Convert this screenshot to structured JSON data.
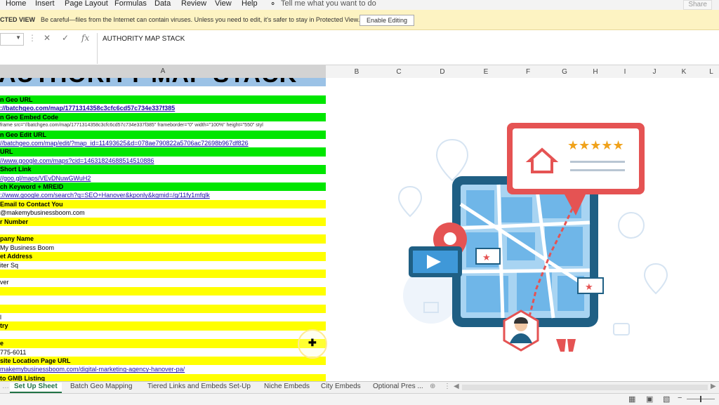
{
  "menu": [
    "Home",
    "Insert",
    "Page Layout",
    "Formulas",
    "Data",
    "Review",
    "View",
    "Help"
  ],
  "tell_me": "Tell me what you want to do",
  "share": "Share",
  "protected_view": {
    "title": "CTED VIEW",
    "message": "Be careful—files from the Internet can contain viruses. Unless you need to edit, it's safer to stay in Protected View.",
    "button": "Enable Editing"
  },
  "formula_bar": {
    "fx": "fx",
    "content": "AUTHORITY MAP STACK"
  },
  "columns": [
    "A",
    "B",
    "C",
    "D",
    "E",
    "F",
    "G",
    "H",
    "I",
    "J",
    "K",
    "L"
  ],
  "banner_text": "AUTHORITY MAP STACK",
  "rows": [
    {
      "style": "green",
      "text": "n Geo URL"
    },
    {
      "style": "linkb",
      "text": "://batchgeo.com/map/1771314358c3cfc6cd57c734e337f385"
    },
    {
      "style": "green",
      "text": "n Geo Embed Code"
    },
    {
      "style": "small",
      "text": "frame src=\"//batchgeo.com/map/1771314358c3cfc6cd57c734e337f385\" frameborder=\"0\" width=\"100%\" height=\"550\" styl"
    },
    {
      "style": "green",
      "text": "n Geo Edit URL"
    },
    {
      "style": "link",
      "text": "//batchgeo.com/map/edit/?map_id=11493625&d=078ae790822a5706ac72698b967df826"
    },
    {
      "style": "green",
      "text": "URL"
    },
    {
      "style": "link",
      "text": "//www.google.com/maps?cid=14631824688514510886"
    },
    {
      "style": "green",
      "text": " Short Link"
    },
    {
      "style": "link",
      "text": "//goo.gl/maps/VEvDNuwGWuH2"
    },
    {
      "style": "green",
      "text": "ch Keyword + MREID"
    },
    {
      "style": "link",
      "text": "://www.google.com/search?q=SEO+Hanover&kponly&kgmid=/g/11fy1mfqlk"
    },
    {
      "style": "yellow",
      "text": "Email to Contact You"
    },
    {
      "style": "plain",
      "text": "@makemybusinessboom.com"
    },
    {
      "style": "yellow",
      "text": "r Number"
    },
    {
      "style": "plain",
      "text": ""
    },
    {
      "style": "yellow",
      "text": "pany Name"
    },
    {
      "style": "plain",
      "text": " My Business Boom"
    },
    {
      "style": "yellow",
      "text": "et Address"
    },
    {
      "style": "plain",
      "text": "iter Sq"
    },
    {
      "style": "yellow",
      "text": ""
    },
    {
      "style": "plain",
      "text": "ver"
    },
    {
      "style": "yellow",
      "text": ""
    },
    {
      "style": "plain",
      "text": ""
    },
    {
      "style": "yellow",
      "text": ""
    },
    {
      "style": "plain",
      "text": "l"
    },
    {
      "style": "yellow",
      "text": "try"
    },
    {
      "style": "plain",
      "text": ""
    },
    {
      "style": "yellow",
      "text": "e"
    },
    {
      "style": "plain",
      "text": " 775-6011"
    },
    {
      "style": "yellow",
      "text": "site Location Page URL"
    },
    {
      "style": "link",
      "text": "makemybusinessboom.com/digital-marketing-agency-hanover-pa/"
    },
    {
      "style": "yellow",
      "text": "to GMB Listing"
    }
  ],
  "sheet_tabs": [
    "Set Up Sheet",
    "Batch Geo Mapping",
    "Tiered Links and Embeds Set-Up",
    "Niche Embeds",
    "City Embeds",
    "Optional Pres ..."
  ],
  "colors": {
    "green": "#00e600",
    "yellow": "#ffff00",
    "banner": "#9bc2e6",
    "map_border": "#1f5f84",
    "pin_red": "#e55353"
  }
}
